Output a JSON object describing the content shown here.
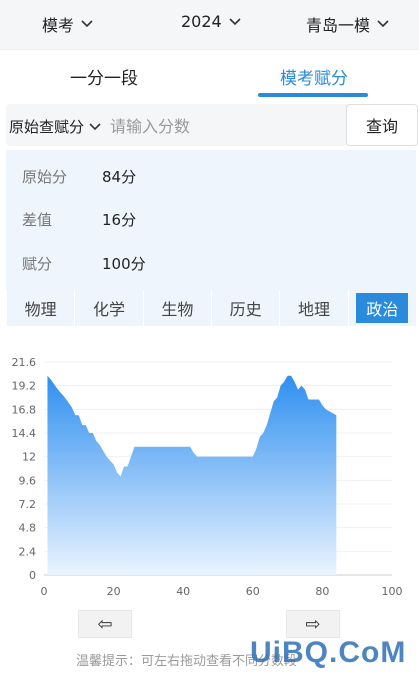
{
  "filters": {
    "type": "模考",
    "year": "2024",
    "exam": "青岛一模"
  },
  "tabs": [
    {
      "label": "一分一段",
      "active": false
    },
    {
      "label": "模考赋分",
      "active": true
    }
  ],
  "search": {
    "mode": "原始查赋分",
    "placeholder": "请输入分数",
    "value": "",
    "button": "查询"
  },
  "result": {
    "raw_label": "原始分",
    "raw_value": "84分",
    "diff_label": "差值",
    "diff_value": "16分",
    "assigned_label": "赋分",
    "assigned_value": "100分"
  },
  "subjects": [
    {
      "label": "物理",
      "active": false
    },
    {
      "label": "化学",
      "active": false
    },
    {
      "label": "生物",
      "active": false
    },
    {
      "label": "历史",
      "active": false
    },
    {
      "label": "地理",
      "active": false
    },
    {
      "label": "政治",
      "active": true
    }
  ],
  "nav": {
    "prev": "⇦",
    "next": "⇨"
  },
  "hint": "温馨提示：可左右拖动查看不同分数段",
  "watermark": "UiBQ.CoM",
  "colors": {
    "accent": "#2a8bdc",
    "area_top": "#2f8ff0",
    "area_bottom": "#eaf4ff"
  },
  "chart_data": {
    "type": "area",
    "xlim": [
      0,
      100
    ],
    "ylim": [
      0,
      21.6
    ],
    "xticks": [
      "0",
      "20",
      "40",
      "60",
      "80",
      "100"
    ],
    "yticks": [
      "0",
      "2.4",
      "4.8",
      "7.2",
      "9.6",
      "12",
      "14.4",
      "16.8",
      "19.2",
      "21.6"
    ],
    "x": [
      1,
      2,
      4,
      6,
      8,
      9,
      10,
      11,
      12,
      13,
      14,
      15,
      16,
      17,
      18,
      20,
      21,
      22,
      23,
      24,
      25,
      26,
      30,
      35,
      40,
      42,
      43,
      44,
      50,
      55,
      60,
      61,
      62,
      63,
      64,
      65,
      66,
      67,
      68,
      69,
      70,
      71,
      72,
      73,
      74,
      75,
      76,
      78,
      79,
      80,
      81,
      82,
      84
    ],
    "y": [
      20.2,
      19.8,
      18.8,
      18,
      17,
      16.2,
      16.2,
      15.2,
      15.2,
      14.4,
      14.4,
      13.6,
      13.2,
      12.6,
      12,
      11.2,
      10.4,
      10.0,
      11.0,
      11.0,
      12.0,
      13.0,
      13.0,
      13.0,
      13.0,
      13.0,
      12.4,
      12.0,
      12.0,
      12.0,
      12.0,
      12.8,
      14.0,
      14.4,
      15.2,
      16.4,
      17.6,
      18.0,
      19.2,
      19.6,
      20.2,
      20.2,
      19.6,
      18.8,
      19.2,
      18.8,
      17.8,
      17.8,
      17.8,
      17.2,
      16.8,
      16.6,
      16.2
    ]
  }
}
